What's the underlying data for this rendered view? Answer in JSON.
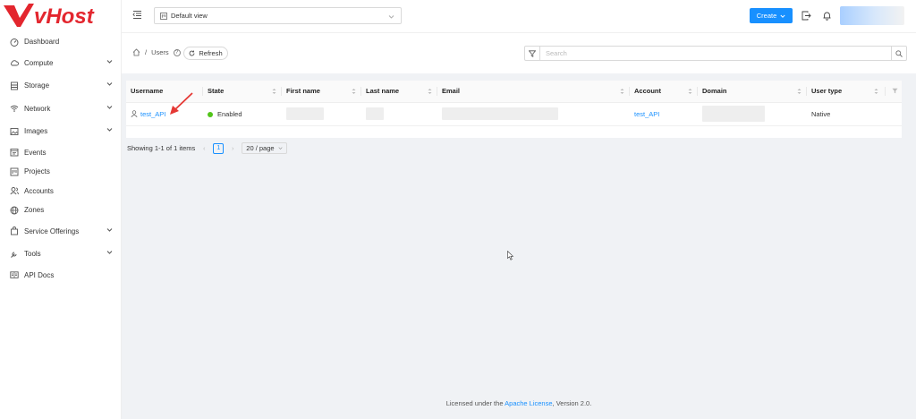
{
  "brand": {
    "name": "vHost",
    "color": "#e3262e"
  },
  "sidebar": {
    "items": [
      {
        "label": "Dashboard",
        "icon": "dashboard-icon",
        "expandable": false
      },
      {
        "label": "Compute",
        "icon": "cloud-icon",
        "expandable": true
      },
      {
        "label": "Storage",
        "icon": "database-icon",
        "expandable": true
      },
      {
        "label": "Network",
        "icon": "wifi-icon",
        "expandable": true
      },
      {
        "label": "Images",
        "icon": "picture-icon",
        "expandable": true
      },
      {
        "label": "Events",
        "icon": "schedule-icon",
        "expandable": false
      },
      {
        "label": "Projects",
        "icon": "project-icon",
        "expandable": false
      },
      {
        "label": "Accounts",
        "icon": "team-icon",
        "expandable": false
      },
      {
        "label": "Zones",
        "icon": "global-icon",
        "expandable": false
      },
      {
        "label": "Service Offerings",
        "icon": "shopping-icon",
        "expandable": true
      },
      {
        "label": "Tools",
        "icon": "tool-icon",
        "expandable": true
      },
      {
        "label": "API Docs",
        "icon": "read-icon",
        "expandable": false
      }
    ]
  },
  "header": {
    "view_select": "Default view",
    "create_label": "Create"
  },
  "breadcrumb": {
    "current": "Users",
    "help": "?"
  },
  "refresh_label": "Refresh",
  "search": {
    "placeholder": "Search"
  },
  "table": {
    "columns": [
      "Username",
      "State",
      "First name",
      "Last name",
      "Email",
      "Account",
      "Domain",
      "User type"
    ],
    "rows": [
      {
        "username": "test_API",
        "state": "Enabled",
        "first_name": "",
        "last_name": "",
        "email": "",
        "account": "test_API",
        "domain": "",
        "user_type": "Native"
      }
    ]
  },
  "pagination": {
    "summary": "Showing 1-1 of 1 items",
    "current_page": "1",
    "page_size": "20 / page"
  },
  "footer": {
    "prefix": "Licensed under the ",
    "link": "Apache License",
    "suffix": ", Version 2.0."
  },
  "colors": {
    "primary": "#1890ff",
    "enabled": "#52c41a",
    "annotation": "#e53935"
  }
}
